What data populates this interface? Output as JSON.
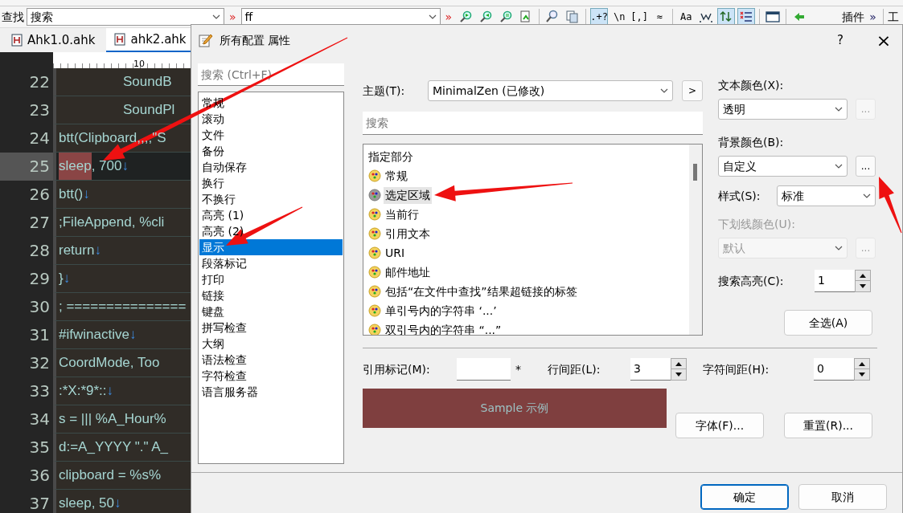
{
  "toolbar": {
    "find_label": "查找",
    "find_value": "搜索",
    "more_1": "»",
    "replace_value": "ff",
    "more_2": "»",
    "buttons": [
      {
        "kind": "icon",
        "on": false
      },
      {
        "kind": "icon",
        "on": false
      },
      {
        "kind": "icon",
        "on": false
      },
      {
        "kind": "icon",
        "on": false
      },
      {
        "kind": "separator"
      },
      {
        "kind": "icon",
        "on": false
      },
      {
        "kind": "icon",
        "on": false
      },
      {
        "kind": "separator"
      },
      {
        "kind": "glyph",
        "text": ".+?",
        "on": true
      },
      {
        "kind": "glyph",
        "text": "\\n",
        "on": false
      },
      {
        "kind": "glyph",
        "text": "[,]",
        "on": false
      },
      {
        "kind": "glyph",
        "text": "≈",
        "on": false
      },
      {
        "kind": "separator"
      },
      {
        "kind": "glyph",
        "text": "Aa",
        "on": false
      },
      {
        "kind": "icon",
        "on": false
      },
      {
        "kind": "icon",
        "on": true
      },
      {
        "kind": "icon",
        "on": true
      },
      {
        "kind": "separator"
      },
      {
        "kind": "icon",
        "on": false
      },
      {
        "kind": "separator"
      },
      {
        "kind": "icon",
        "on": false
      }
    ],
    "plugins": "插件",
    "plugins_more": "»",
    "tools": "工"
  },
  "tabs": [
    {
      "label": "Ahk1.0.ahk",
      "selected": false
    },
    {
      "label": "ahk2.ahk",
      "selected": true
    }
  ],
  "ruler": {
    "mark": "10"
  },
  "editor": {
    "lines": [
      {
        "number": "22",
        "text": "\t\tSoundB",
        "current": false
      },
      {
        "number": "23",
        "text": "\t\tSoundPl",
        "current": false
      },
      {
        "number": "24",
        "text": "btt(Clipboard,,,,\"S",
        "current": false
      },
      {
        "number": "25",
        "highlight": "sleep",
        "text": ", 700",
        "eol": "↓",
        "current": true
      },
      {
        "number": "26",
        "text": "btt()",
        "eol": "↓",
        "current": false
      },
      {
        "number": "27",
        "text": ";FileAppend, %cli",
        "current": false
      },
      {
        "number": "28",
        "text": "return",
        "eol": "↓",
        "current": false
      },
      {
        "number": "29",
        "text": "}",
        "eol": "↓",
        "current": false
      },
      {
        "number": "30",
        "text": "; ===============",
        "current": false
      },
      {
        "number": "31",
        "text": "#ifwinactive",
        "eol": "↓",
        "current": false
      },
      {
        "number": "32",
        "text": "CoordMode, Too",
        "current": false
      },
      {
        "number": "33",
        "text": ":*X:*9*::",
        "eol": "↓",
        "current": false
      },
      {
        "number": "34",
        "text": "s = ||| %A_Hour%",
        "current": false
      },
      {
        "number": "35",
        "text": "d:=A_YYYY \".\" A_",
        "current": false
      },
      {
        "number": "36",
        "text": "clipboard = %s%",
        "current": false
      },
      {
        "number": "37",
        "text": "sleep, 50",
        "eol": "↓",
        "current": false
      }
    ]
  },
  "dialog": {
    "title": "所有配置 属性",
    "help": "?",
    "close": "×",
    "category_search": {
      "placeholder": "搜索 (Ctrl+F)"
    },
    "categories": [
      {
        "label": "常规",
        "selected": false
      },
      {
        "label": "滚动",
        "selected": false
      },
      {
        "label": "文件",
        "selected": false
      },
      {
        "label": "备份",
        "selected": false
      },
      {
        "label": "自动保存",
        "selected": false
      },
      {
        "label": "换行",
        "selected": false
      },
      {
        "label": "不换行",
        "selected": false
      },
      {
        "label": "高亮 (1)",
        "selected": false
      },
      {
        "label": "高亮 (2)",
        "selected": false
      },
      {
        "label": "显示",
        "selected": true
      },
      {
        "label": "段落标记",
        "selected": false
      },
      {
        "label": "打印",
        "selected": false
      },
      {
        "label": "链接",
        "selected": false
      },
      {
        "label": "键盘",
        "selected": false
      },
      {
        "label": "拼写检查",
        "selected": false
      },
      {
        "label": "大纲",
        "selected": false
      },
      {
        "label": "语法检查",
        "selected": false
      },
      {
        "label": "字符检查",
        "selected": false
      },
      {
        "label": "语言服务器",
        "selected": false
      }
    ],
    "theme": {
      "label": "主题(T):",
      "value": "MinimalZen (已修改)",
      "button": ">"
    },
    "part_search": {
      "placeholder": "搜索"
    },
    "parts": [
      {
        "kind": "header",
        "label": "指定部分"
      },
      {
        "kind": "item",
        "label": "常规",
        "selected": false
      },
      {
        "kind": "item",
        "label": "选定区域",
        "selected": true
      },
      {
        "kind": "item",
        "label": "当前行",
        "selected": false
      },
      {
        "kind": "item",
        "label": "引用文本",
        "selected": false
      },
      {
        "kind": "item",
        "label": "URI",
        "selected": false
      },
      {
        "kind": "item",
        "label": "邮件地址",
        "selected": false
      },
      {
        "kind": "item",
        "label": "包括“在文件中查找”结果超链接的标签",
        "selected": false
      },
      {
        "kind": "item",
        "label": "单引号内的字符串  ‘...’",
        "selected": false
      },
      {
        "kind": "item",
        "label": "双引号内的字符串  “...”",
        "selected": false
      }
    ],
    "fields": [
      {
        "kind": "color",
        "label": "文本颜色(X):",
        "value": "透明",
        "disabled": false,
        "button": "...",
        "button_disabled": true
      },
      {
        "kind": "color",
        "label": "背景颜色(B):",
        "value": "自定义",
        "disabled": false,
        "button": "...",
        "button_disabled": false
      },
      {
        "kind": "select",
        "label": "样式(S):",
        "value": "标准",
        "disabled": false
      },
      {
        "kind": "color",
        "label": "下划线颜色(U):",
        "value": "默认",
        "disabled": true,
        "button": "...",
        "button_disabled": true
      },
      {
        "kind": "spin",
        "label": "搜索高亮(C):",
        "value": "1"
      }
    ],
    "select_all": "全选(A)",
    "spacing": [
      {
        "kind": "text",
        "label": "引用标记(M):",
        "suffix": "*"
      },
      {
        "kind": "spin",
        "label": "行间距(L):",
        "value": "3"
      },
      {
        "kind": "spin",
        "label": "字符间距(H):",
        "value": "0"
      }
    ],
    "sample": {
      "text": "Sample 示例"
    },
    "font_button": "字体(F)...",
    "reset_button": "重置(R)...",
    "ok": {
      "label": "确定",
      "default": true
    },
    "cancel": {
      "label": "取消",
      "default": false
    }
  }
}
